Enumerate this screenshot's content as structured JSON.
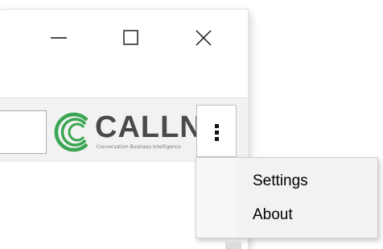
{
  "window": {
    "caption_buttons": [
      {
        "name": "minimize",
        "icon": "minimize-icon"
      },
      {
        "name": "maximize",
        "icon": "maximize-icon"
      },
      {
        "name": "close",
        "icon": "close-icon"
      }
    ]
  },
  "toolbar": {
    "search_value": "",
    "logo": {
      "text": "CALLN",
      "tagline": "Conversation Business Intelligence",
      "icon": "callminer-logo-c-icon"
    },
    "overflow_menu_icon": "kebab-menu-icon"
  },
  "menu": {
    "items": [
      {
        "label": "Settings"
      },
      {
        "label": "About"
      }
    ]
  },
  "colors": {
    "logo_green": "#3aa552",
    "logo_gray": "#4a4a4a",
    "toolbar_bg": "#f2f2f2",
    "menu_bg": "#f2f2f2"
  }
}
